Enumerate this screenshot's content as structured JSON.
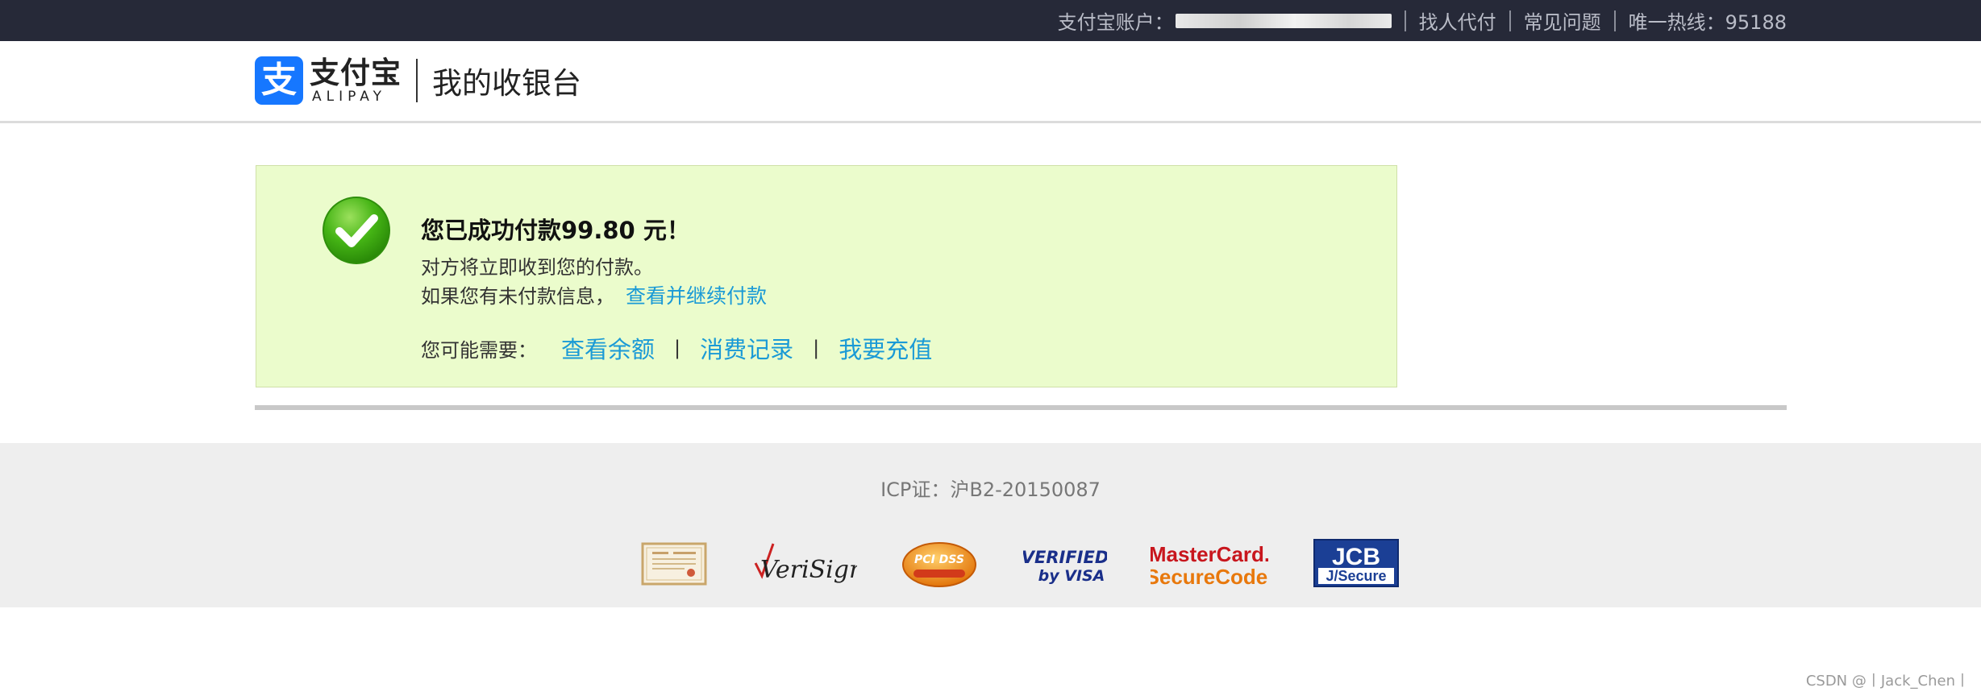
{
  "topbar": {
    "account_label": "支付宝账户：",
    "links": [
      "找人代付",
      "常见问题"
    ],
    "hotline": "唯一热线：95188"
  },
  "header": {
    "logo_char": "支",
    "logo_cn": "支付宝",
    "logo_en": "ALIPAY",
    "title": "我的收银台"
  },
  "panel": {
    "title": "您已成功付款99.80 元！",
    "line1": "对方将立即收到您的付款。",
    "line2_text": "如果您有未付款信息，",
    "line2_link": "查看并继续付款",
    "maybe_label": "您可能需要：",
    "actions": [
      "查看余额",
      "消费记录",
      "我要充值"
    ],
    "separator": "|"
  },
  "footer": {
    "icp": "ICP证：沪B2-20150087",
    "badges": {
      "verisign": "VeriSign",
      "pcidss": "PCI DSS",
      "visa_top": "VERIFIED",
      "visa_bottom": "by VISA",
      "mc_top": "MasterCard.",
      "mc_bottom": "SecureCode.",
      "jcb_top": "JCB",
      "jcb_bottom": "J/Secure"
    }
  },
  "watermark": "CSDN @丨Jack_Chen丨",
  "colors": {
    "topbar_bg": "#262938",
    "brand_blue": "#1677ff",
    "link_blue": "#1a9ad6",
    "panel_bg": "#ebfccc",
    "success_green": "#3aa80e",
    "footer_bg": "#eeeeee"
  }
}
